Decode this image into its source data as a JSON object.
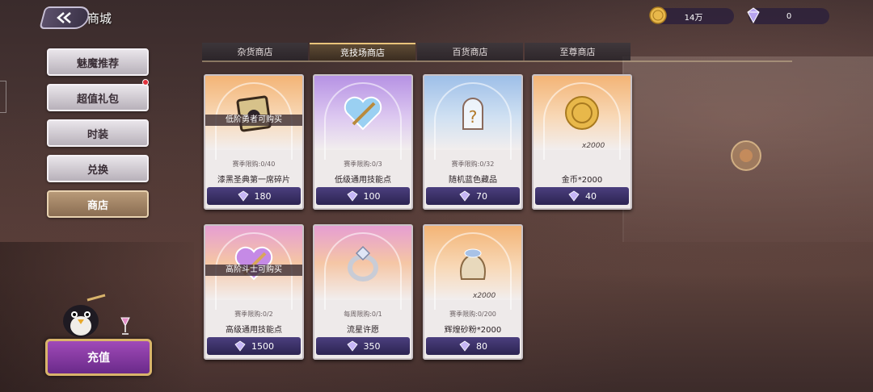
{
  "header": {
    "title": "商城",
    "gold": "14万",
    "gems": "0"
  },
  "sidebar": {
    "items": [
      {
        "label": "魅魔推荐",
        "active": false
      },
      {
        "label": "超值礼包",
        "active": false,
        "badge": true
      },
      {
        "label": "时装",
        "active": false
      },
      {
        "label": "兑换",
        "active": false
      },
      {
        "label": "商店",
        "active": true
      }
    ]
  },
  "tabs": [
    {
      "label": "杂货商店",
      "active": false
    },
    {
      "label": "竞技场商店",
      "active": true
    },
    {
      "label": "百货商店",
      "active": false
    },
    {
      "label": "至尊商店",
      "active": false
    }
  ],
  "cards": [
    {
      "theme": "orange",
      "icon": "scroll-fragment-icon",
      "banner": "低阶勇者可购买",
      "limit": "赛季限购:0/40",
      "name": "漆黑圣典第一席碎片",
      "price": "180"
    },
    {
      "theme": "purple",
      "icon": "heart-crystal-icon",
      "banner": "",
      "limit": "赛季限购:0/3",
      "name": "低级通用技能点",
      "price": "100"
    },
    {
      "theme": "blue",
      "icon": "mystery-jar-icon",
      "banner": "",
      "limit": "赛季限购:0/32",
      "name": "随机蓝色藏品",
      "price": "70"
    },
    {
      "theme": "orange",
      "icon": "gold-coin-icon",
      "banner": "",
      "qty": "x2000",
      "limit": "",
      "name": "金币*2000",
      "price": "40"
    },
    {
      "theme": "rainbow",
      "icon": "heart-crystal-pink-icon",
      "banner": "高阶斗士可购买",
      "limit": "赛季限购:0/2",
      "name": "高级通用技能点",
      "price": "1500"
    },
    {
      "theme": "rainbow",
      "icon": "diamond-ring-icon",
      "banner": "",
      "limit": "每周限购:0/1",
      "name": "流星许愿",
      "price": "350"
    },
    {
      "theme": "orange",
      "icon": "sand-bag-icon",
      "banner": "",
      "qty": "x2000",
      "limit": "赛季限购:0/200",
      "name": "辉煌砂粉*2000",
      "price": "80"
    }
  ],
  "recharge": {
    "label": "充值"
  },
  "colors": {
    "accent_gold": "#e9c47b",
    "price_bar": "#2c2452",
    "badge_red": "#e0303b"
  }
}
